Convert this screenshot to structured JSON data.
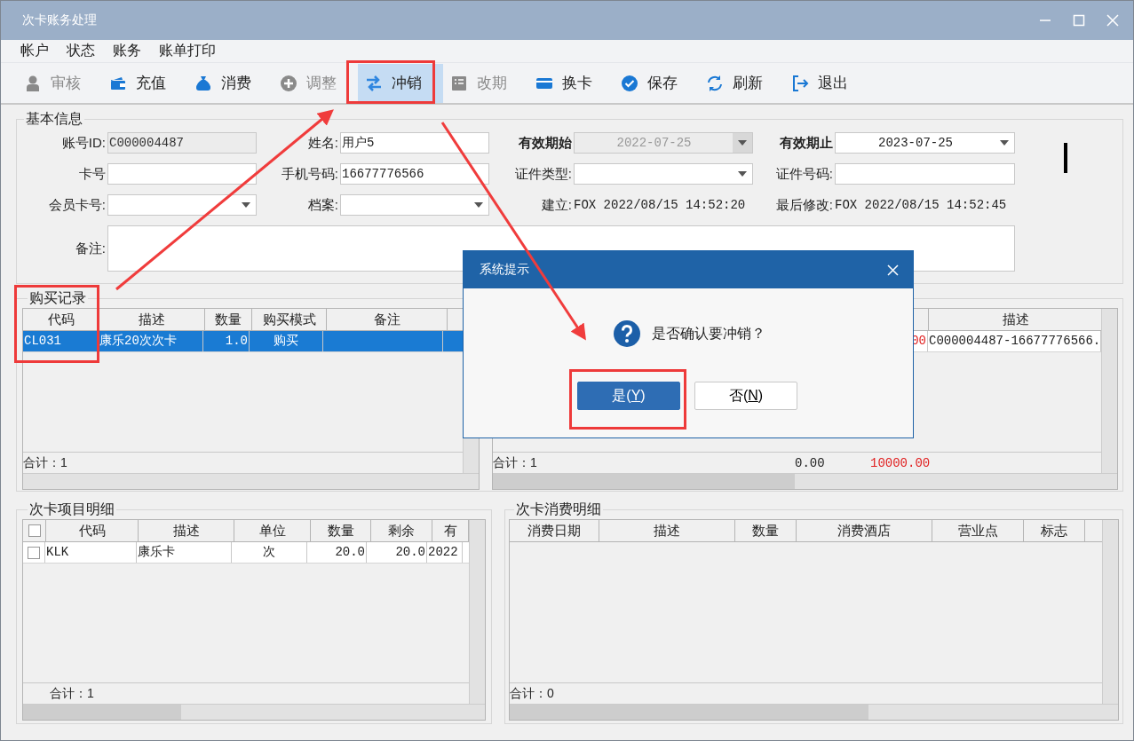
{
  "window": {
    "title": "次卡账务处理"
  },
  "menu": [
    "帐户",
    "状态",
    "账务",
    "账单打印"
  ],
  "toolbar": [
    {
      "label": "审核",
      "kind": "person",
      "disabled": true,
      "selected": false
    },
    {
      "label": "充值",
      "kind": "wallet",
      "disabled": false,
      "selected": false
    },
    {
      "label": "消费",
      "kind": "bag",
      "disabled": false,
      "selected": false
    },
    {
      "label": "调整",
      "kind": "plus",
      "disabled": true,
      "selected": false
    },
    {
      "label": "冲销",
      "kind": "swap",
      "disabled": false,
      "selected": true
    },
    {
      "label": "改期",
      "kind": "list",
      "disabled": true,
      "selected": false
    },
    {
      "label": "换卡",
      "kind": "card",
      "disabled": false,
      "selected": false
    },
    {
      "label": "保存",
      "kind": "check",
      "disabled": false,
      "selected": false
    },
    {
      "label": "刷新",
      "kind": "refresh",
      "disabled": false,
      "selected": false
    },
    {
      "label": "退出",
      "kind": "exit",
      "disabled": false,
      "selected": false
    }
  ],
  "basic_info": {
    "title": "基本信息",
    "fields": [
      {
        "kind": "label",
        "text": "账号ID:",
        "bold": false
      },
      {
        "kind": "input",
        "value": "C000004487",
        "disabled": true
      },
      {
        "kind": "label",
        "text": "姓名:",
        "bold": false
      },
      {
        "kind": "input",
        "value": "用户5",
        "disabled": false
      },
      {
        "kind": "label",
        "text": "有效期始",
        "bold": true
      },
      {
        "kind": "combo",
        "value": "2022-07-25",
        "disabled": true
      },
      {
        "kind": "label",
        "text": "有效期止",
        "bold": true
      },
      {
        "kind": "combo",
        "value": "2023-07-25",
        "disabled": false
      },
      {
        "kind": "label",
        "text": "卡号",
        "bold": false
      },
      {
        "kind": "input",
        "disabled": false
      },
      {
        "kind": "label",
        "text": "手机号码:",
        "bold": false
      },
      {
        "kind": "input",
        "value": "16677776566",
        "disabled": false
      },
      {
        "kind": "label",
        "text": "证件类型:",
        "bold": false
      },
      {
        "kind": "combo",
        "disabled": false
      },
      {
        "kind": "label",
        "text": "证件号码:",
        "bold": false
      },
      {
        "kind": "input",
        "disabled": false
      },
      {
        "kind": "label",
        "text": "会员卡号:",
        "bold": false
      },
      {
        "kind": "combo",
        "disabled": false
      },
      {
        "kind": "label",
        "text": "档案:",
        "bold": false
      },
      {
        "kind": "combo",
        "disabled": false
      },
      {
        "kind": "label",
        "text": "建立:",
        "bold": false
      },
      {
        "kind": "text",
        "text": "FOX  2022/08/15 14:52:20"
      },
      {
        "kind": "label",
        "text": "最后修改:",
        "bold": false
      },
      {
        "kind": "text",
        "text": "FOX  2022/08/15 14:52:45"
      },
      {
        "kind": "label",
        "text": "备注:",
        "bold": false
      },
      {
        "kind": "memo",
        "disabled": false
      }
    ]
  },
  "purchase_records": {
    "title": "购买记录",
    "columns": [
      "代码",
      "描述",
      "数量",
      "购买模式",
      "备注"
    ],
    "rows": [
      {
        "cells": [
          "CL031",
          "康乐20次次卡",
          "1.0",
          "购买"
        ],
        "selected": true
      }
    ],
    "total": "合计：1"
  },
  "payments": {
    "columns": [
      "描述"
    ],
    "rows": [
      {
        "amount": "00",
        "description": "C000004487-16677776566."
      }
    ],
    "total": "合计：1",
    "sum_1": "0.00",
    "sum_2": "10000.00"
  },
  "card_items": {
    "title": "次卡项目明细",
    "header_checked": false,
    "columns": [
      "代码",
      "描述",
      "单位",
      "数量",
      "剩余",
      "有"
    ],
    "rows": [
      {
        "checked": false,
        "cells": [
          "KLK",
          "康乐卡",
          "次",
          "20.0",
          "20.0",
          "2022"
        ]
      }
    ],
    "total": "合计：1"
  },
  "consumption": {
    "title": "次卡消费明细",
    "columns": [
      "消费日期",
      "描述",
      "数量",
      "消费酒店",
      "营业点",
      "标志"
    ],
    "total": "合计：0"
  },
  "dialog": {
    "title": "系统提示",
    "message": "是否确认要冲销？",
    "buttons": [
      {
        "text_before": "是(",
        "hotkey": "Y",
        "text_after": ")",
        "selected": true
      },
      {
        "text_before": "否(",
        "hotkey": "N",
        "text_after": ")",
        "selected": false
      }
    ]
  }
}
